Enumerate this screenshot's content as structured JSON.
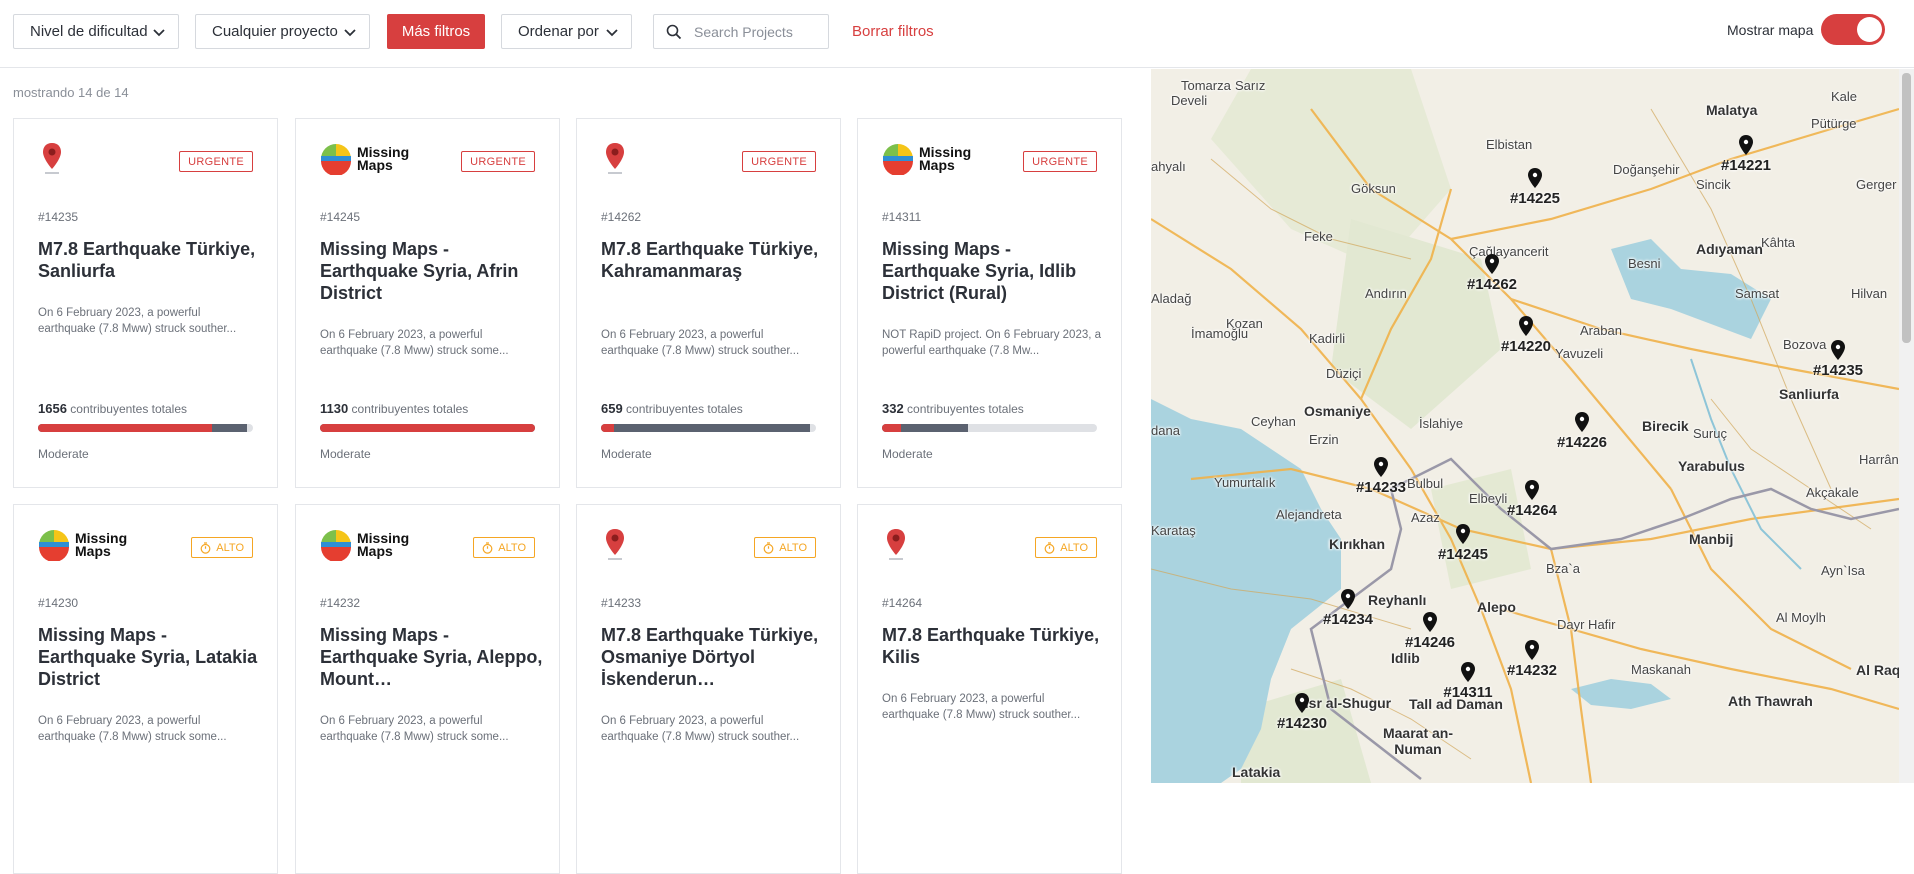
{
  "filters": {
    "difficulty": "Nivel de dificultad",
    "project": "Cualquier proyecto",
    "more": "Más filtros",
    "sort": "Ordenar por",
    "search_placeholder": "Search Projects",
    "clear": "Borrar filtros",
    "map_toggle_label": "Mostrar mapa",
    "map_toggle_on": true
  },
  "results_count": "mostrando 14 de 14",
  "colors": {
    "accent": "#d73f3f",
    "alto": "#f5a623",
    "progress_mapped": "#d73f3f",
    "progress_validated": "#5b6270"
  },
  "cards": [
    {
      "logo": "pin-logo",
      "badge": "URGENTE",
      "badge_type": "urgent",
      "id": "#14235",
      "title": "M7.8 Earthquake Türkiye, Sanliurfa",
      "desc": "On 6 February 2023, a powerful earthquake (7.8 Mww) struck souther...",
      "contributors": "1656",
      "contrib_label": "contribuyentes totales",
      "mapped_pct": 81,
      "validated_pct": 97,
      "difficulty": "Moderate"
    },
    {
      "logo": "missing-maps",
      "logo_text1": "Missing",
      "logo_text2": "Maps",
      "badge": "URGENTE",
      "badge_type": "urgent",
      "id": "#14245",
      "title": "Missing Maps - Earthquake Syria, Afrin District",
      "desc": "On 6 February 2023, a powerful earthquake (7.8 Mww) struck some...",
      "contributors": "1130",
      "contrib_label": "contribuyentes totales",
      "mapped_pct": 100,
      "validated_pct": 100,
      "difficulty": "Moderate"
    },
    {
      "logo": "pin-logo",
      "badge": "URGENTE",
      "badge_type": "urgent",
      "id": "#14262",
      "title": "M7.8 Earthquake Türkiye, Kahramanmaraş",
      "desc": "On 6 February 2023, a powerful earthquake (7.8 Mww) struck souther...",
      "contributors": "659",
      "contrib_label": "contribuyentes totales",
      "mapped_pct": 6,
      "validated_pct": 97,
      "difficulty": "Moderate"
    },
    {
      "logo": "missing-maps",
      "logo_text1": "Missing",
      "logo_text2": "Maps",
      "badge": "URGENTE",
      "badge_type": "urgent",
      "id": "#14311",
      "title": "Missing Maps - Earthquake Syria, Idlib District (Rural)",
      "desc": "NOT RapiD project. On 6 February 2023, a powerful earthquake (7.8 Mw...",
      "contributors": "332",
      "contrib_label": "contribuyentes totales",
      "mapped_pct": 9,
      "validated_pct": 40,
      "difficulty": "Moderate"
    },
    {
      "logo": "missing-maps",
      "logo_text1": "Missing",
      "logo_text2": "Maps",
      "badge": "ALTO",
      "badge_type": "alto",
      "id": "#14230",
      "title": "Missing Maps - Earthquake Syria, Latakia District",
      "desc": "On 6 February 2023, a powerful earthquake (7.8 Mww) struck some..."
    },
    {
      "logo": "missing-maps",
      "logo_text1": "Missing",
      "logo_text2": "Maps",
      "badge": "ALTO",
      "badge_type": "alto",
      "id": "#14232",
      "title": "Missing Maps - Earthquake Syria, Aleppo, Mount…",
      "desc": "On 6 February 2023, a powerful earthquake (7.8 Mww) struck some..."
    },
    {
      "logo": "pin-logo",
      "badge": "ALTO",
      "badge_type": "alto",
      "id": "#14233",
      "title": "M7.8 Earthquake Türkiye, Osmaniye Dörtyol İskenderun…",
      "desc": "On 6 February 2023, a powerful earthquake (7.8 Mww) struck souther..."
    },
    {
      "logo": "pin-logo",
      "badge": "ALTO",
      "badge_type": "alto",
      "id": "#14264",
      "title": "M7.8 Earthquake Türkiye, Kilis",
      "desc": "On 6 February 2023, a powerful earthquake (7.8 Mww) struck souther..."
    }
  ],
  "map": {
    "pins": [
      "#14221",
      "#14225",
      "#14262",
      "#14220",
      "#14235",
      "#14226",
      "#14233",
      "#14264",
      "#14245",
      "#14234",
      "#14246",
      "#14232",
      "#14311",
      "#14230"
    ],
    "places": [
      "Tomarza",
      "Sarız",
      "Develi",
      "Kale",
      "Malatya",
      "Pütürge",
      "ahyalı",
      "Elbistan",
      "Göksun",
      "Doğanşehir",
      "Sincik",
      "Gerger",
      "Feke",
      "Çağlayancerit",
      "Adıyaman",
      "Kâhta",
      "Besni",
      "Aladağ",
      "Andırın",
      "Samsat",
      "Hilvan",
      "Kozan",
      "Kadirli",
      "Araban",
      "İmamoğlu",
      "Yavuzeli",
      "Bozova",
      "Düziçi",
      "Sanliurfa",
      "Osmaniye",
      "Ceyhan",
      "İslahiye",
      "Birecik",
      "Suruç",
      "dana",
      "Erzin",
      "Yarabulus",
      "Harrân",
      "Yumurtalık",
      "Bulbul",
      "Akçakale",
      "Elbeyli",
      "Alejandreta",
      "Azaz",
      "Karataş",
      "Kırıkhan",
      "Manbij",
      "Bza`a",
      "Ayn`Isa",
      "Reyhanlı",
      "Alepo",
      "Dayr Hafir",
      "Al Moylh",
      "Idlib",
      "Maskanah",
      "Al Raqa",
      "Jisr al-Shugur",
      "Tall ad Daman",
      "Ath Thawrah",
      "Maarat an-Numan",
      "Latakia"
    ]
  }
}
